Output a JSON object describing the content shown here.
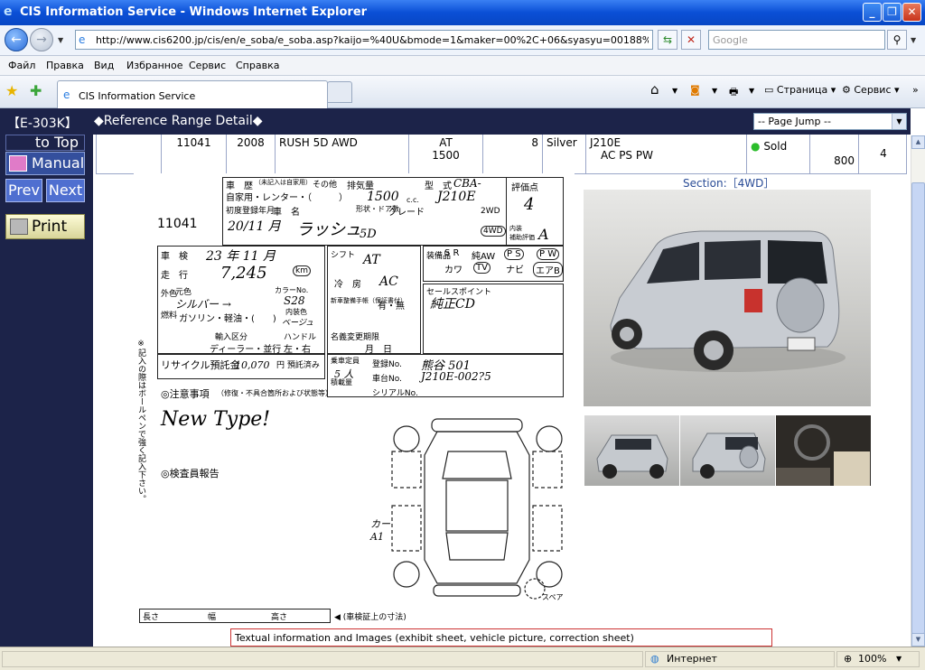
{
  "window": {
    "title": "CIS Information Service - Windows Internet Explorer"
  },
  "address": {
    "url": "http://www.cis6200.jp/cis/en/e_soba/e_soba.asp?kaijo=%40U&bmode=1&maker=00%2C+06&syasyu=00188%2C+06702",
    "search_placeholder": "Google"
  },
  "menu": [
    "Файл",
    "Правка",
    "Вид",
    "Избранное",
    "Сервис",
    "Справка"
  ],
  "tab": {
    "label": "CIS Information Service"
  },
  "toolbar": {
    "page": "Страница",
    "tools": "Сервис"
  },
  "header": {
    "code": "【E-303K】",
    "title": "◆Reference Range Detail◆",
    "jump": "-- Page Jump --"
  },
  "nav": {
    "top": "to Top",
    "manual": "Manual",
    "prev": "Prev",
    "next": "Next",
    "print": "Print"
  },
  "row": {
    "lot": "11041",
    "year": "2008",
    "model": "RUSH 5D AWD",
    "trans": "AT",
    "cc": "1500",
    "grade_num": "8",
    "color": "Silver",
    "chassis": "J210E",
    "equip": "AC PS PW",
    "status": "Sold",
    "price": "800",
    "score": "4"
  },
  "sheet": {
    "lot": "11041",
    "history_label": "車　歴",
    "history_note": "（未記入は自家用）",
    "other_label": "その他",
    "usage": "自家用・レンター・（　　　）",
    "displacement_label": "排気量",
    "displacement": "1500",
    "cc_unit": "c.c.",
    "model_label": "型　式",
    "model_code": "CBA-",
    "model_value": "J210E",
    "grade_label": "評価点",
    "grade": "4",
    "reg_label": "初度登録年月",
    "reg": "20/11 月",
    "name_label": "車　名",
    "name": "ラッシュ",
    "doors_label": "形状・ドア数",
    "doors": "5D",
    "grade_col_label": "グレード",
    "drive_label": "2WD",
    "drive": "4WD",
    "interior_label": "内装\n補助評価",
    "interior": "A",
    "inspect_label": "車　検",
    "inspect": "23 年 11 月",
    "mileage_label": "走　行",
    "mileage": "7,245",
    "km": "km",
    "color_label": "外色",
    "orig_color": "元色",
    "color_value": "シルバー →",
    "color_no_label": "カラーNo.",
    "color_no": "S28",
    "fuel_label": "燃料",
    "fuel": "ガソリン・軽油・(　　)",
    "interior_color": "内装色",
    "interior_color_value": "ベージュ",
    "import_label": "輸入区分",
    "dealer": "ディーラー・並行",
    "handle_label": "ハンドル",
    "handle": "左・右",
    "shift_label": "シフト",
    "shift": "AT",
    "ac_label": "冷　房",
    "ac": "AC",
    "manual_label": "新車整備手帳（保証書付）",
    "manual_value": "有・無",
    "equip_label": "装備品",
    "equip_sr": "S R",
    "equip_aw": "純AW",
    "equip_ps": "P S",
    "equip_pw": "P W",
    "equip_tv": "カワ",
    "equip_tv2": "TV",
    "equip_navi": "ナビ",
    "equip_airbag": "エアB",
    "sales_label": "セールスポイント",
    "sales": "純正CD",
    "rename_label": "名義変更期限",
    "rename": "月　日",
    "recycle_label": "リサイクル預託金",
    "recycle": "10,070",
    "recycle_unit": "円 預託済み",
    "capacity_label": "乗車定員",
    "capacity": "5 人",
    "plate_label": "登録No.",
    "plate": "熊谷 501",
    "chassis_label": "車台No.",
    "chassis": "J210E-002?5",
    "load_label": "積載量",
    "serial_label": "シリアルNo.",
    "caution_label": "◎注意事項",
    "caution_note": "（修復・不具合箇所および状態等）",
    "caution": "New Type!",
    "inspector_label": "◎検査員報告",
    "damage": "カー\nA1",
    "bottom_len": "長さ",
    "bottom_wid": "幅",
    "bottom_hgt": "高さ",
    "bottom_note": "◀ (車検証上の寸法)",
    "spare": "スペア",
    "side_text": "※記入の際はボールペンで強く記入下さい。"
  },
  "section": {
    "label": "Section:［4WD］"
  },
  "note": {
    "text": "Textual information and Images (exhibit sheet, vehicle picture, correction sheet)"
  },
  "status": {
    "zone": "Интернет",
    "zoom": "100%"
  }
}
